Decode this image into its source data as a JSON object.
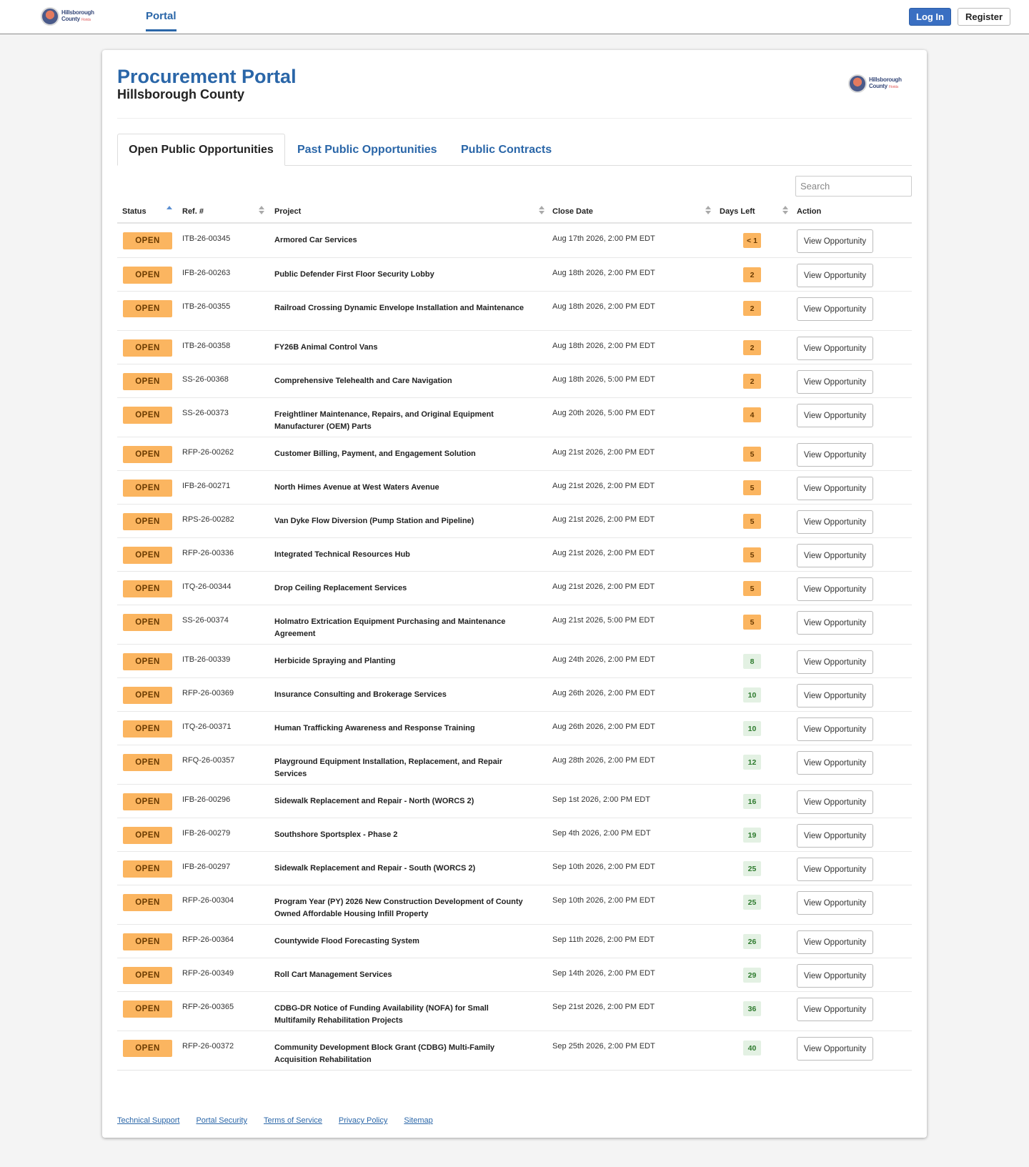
{
  "nav": {
    "logo_line1": "Hillsborough",
    "logo_line2": "County",
    "logo_tag": "Florida",
    "portal_label": "Portal",
    "login_label": "Log In",
    "register_label": "Register"
  },
  "header": {
    "title": "Procurement Portal",
    "subtitle": "Hillsborough County"
  },
  "tabs": [
    {
      "label": "Open Public Opportunities",
      "active": true
    },
    {
      "label": "Past Public Opportunities",
      "active": false
    },
    {
      "label": "Public Contracts",
      "active": false
    }
  ],
  "search": {
    "placeholder": "Search",
    "value": ""
  },
  "table": {
    "columns": [
      "Status",
      "Ref. #",
      "Project",
      "Close Date",
      "Days Left",
      "Action"
    ],
    "sorted_by": "Status",
    "sort_direction": "ascending",
    "action_label": "View Opportunity",
    "rows": [
      {
        "status": "OPEN",
        "ref": "ITB-26-00345",
        "project": "Armored Car Services",
        "close": "Aug 17th 2026, 2:00 PM EDT",
        "days": "< 1",
        "urgency": "warn"
      },
      {
        "status": "OPEN",
        "ref": "IFB-26-00263",
        "project": "Public Defender First Floor Security Lobby",
        "close": "Aug 18th 2026, 2:00 PM EDT",
        "days": "2",
        "urgency": "warn"
      },
      {
        "status": "OPEN",
        "ref": "ITB-26-00355",
        "project": "Railroad Crossing Dynamic Envelope Installation and Maintenance",
        "close": "Aug 18th 2026, 2:00 PM EDT",
        "days": "2",
        "urgency": "warn"
      },
      {
        "status": "OPEN",
        "ref": "ITB-26-00358",
        "project": "FY26B Animal Control Vans",
        "close": "Aug 18th 2026, 2:00 PM EDT",
        "days": "2",
        "urgency": "warn"
      },
      {
        "status": "OPEN",
        "ref": "SS-26-00368",
        "project": "Comprehensive Telehealth and Care Navigation",
        "close": "Aug 18th 2026, 5:00 PM EDT",
        "days": "2",
        "urgency": "warn"
      },
      {
        "status": "OPEN",
        "ref": "SS-26-00373",
        "project": "Freightliner Maintenance, Repairs, and Original Equipment Manufacturer (OEM) Parts",
        "close": "Aug 20th 2026, 5:00 PM EDT",
        "days": "4",
        "urgency": "warn"
      },
      {
        "status": "OPEN",
        "ref": "RFP-26-00262",
        "project": "Customer Billing, Payment, and Engagement Solution",
        "close": "Aug 21st 2026, 2:00 PM EDT",
        "days": "5",
        "urgency": "warn"
      },
      {
        "status": "OPEN",
        "ref": "IFB-26-00271",
        "project": "North Himes Avenue at West Waters Avenue",
        "close": "Aug 21st 2026, 2:00 PM EDT",
        "days": "5",
        "urgency": "warn"
      },
      {
        "status": "OPEN",
        "ref": "RPS-26-00282",
        "project": "Van Dyke Flow Diversion (Pump Station and Pipeline)",
        "close": "Aug 21st 2026, 2:00 PM EDT",
        "days": "5",
        "urgency": "warn"
      },
      {
        "status": "OPEN",
        "ref": "RFP-26-00336",
        "project": "Integrated Technical Resources Hub",
        "close": "Aug 21st 2026, 2:00 PM EDT",
        "days": "5",
        "urgency": "warn"
      },
      {
        "status": "OPEN",
        "ref": "ITQ-26-00344",
        "project": "Drop Ceiling Replacement Services",
        "close": "Aug 21st 2026, 2:00 PM EDT",
        "days": "5",
        "urgency": "warn"
      },
      {
        "status": "OPEN",
        "ref": "SS-26-00374",
        "project": "Holmatro Extrication Equipment Purchasing and Maintenance Agreement",
        "close": "Aug 21st 2026, 5:00 PM EDT",
        "days": "5",
        "urgency": "warn"
      },
      {
        "status": "OPEN",
        "ref": "ITB-26-00339",
        "project": "Herbicide Spraying and Planting",
        "close": "Aug 24th 2026, 2:00 PM EDT",
        "days": "8",
        "urgency": "ok"
      },
      {
        "status": "OPEN",
        "ref": "RFP-26-00369",
        "project": "Insurance Consulting and Brokerage Services",
        "close": "Aug 26th 2026, 2:00 PM EDT",
        "days": "10",
        "urgency": "ok"
      },
      {
        "status": "OPEN",
        "ref": "ITQ-26-00371",
        "project": "Human Trafficking Awareness and Response Training",
        "close": "Aug 26th 2026, 2:00 PM EDT",
        "days": "10",
        "urgency": "ok"
      },
      {
        "status": "OPEN",
        "ref": "RFQ-26-00357",
        "project": "Playground Equipment Installation, Replacement, and Repair Services",
        "close": "Aug 28th 2026, 2:00 PM EDT",
        "days": "12",
        "urgency": "ok"
      },
      {
        "status": "OPEN",
        "ref": "IFB-26-00296",
        "project": "Sidewalk Replacement and Repair - North (WORCS 2)",
        "close": "Sep 1st 2026, 2:00 PM EDT",
        "days": "16",
        "urgency": "ok"
      },
      {
        "status": "OPEN",
        "ref": "IFB-26-00279",
        "project": "Southshore Sportsplex - Phase 2",
        "close": "Sep 4th 2026, 2:00 PM EDT",
        "days": "19",
        "urgency": "ok"
      },
      {
        "status": "OPEN",
        "ref": "IFB-26-00297",
        "project": "Sidewalk Replacement and Repair - South (WORCS 2)",
        "close": "Sep 10th 2026, 2:00 PM EDT",
        "days": "25",
        "urgency": "ok"
      },
      {
        "status": "OPEN",
        "ref": "RFP-26-00304",
        "project": "Program Year (PY) 2026 New Construction Development of County Owned Affordable Housing Infill Property",
        "close": "Sep 10th 2026, 2:00 PM EDT",
        "days": "25",
        "urgency": "ok"
      },
      {
        "status": "OPEN",
        "ref": "RFP-26-00364",
        "project": "Countywide Flood Forecasting System",
        "close": "Sep 11th 2026, 2:00 PM EDT",
        "days": "26",
        "urgency": "ok"
      },
      {
        "status": "OPEN",
        "ref": "RFP-26-00349",
        "project": "Roll Cart Management Services",
        "close": "Sep 14th 2026, 2:00 PM EDT",
        "days": "29",
        "urgency": "ok"
      },
      {
        "status": "OPEN",
        "ref": "RFP-26-00365",
        "project": "CDBG-DR Notice of Funding Availability (NOFA) for Small Multifamily Rehabilitation Projects",
        "close": "Sep 21st 2026, 2:00 PM EDT",
        "days": "36",
        "urgency": "ok"
      },
      {
        "status": "OPEN",
        "ref": "RFP-26-00372",
        "project": "Community Development Block Grant (CDBG) Multi-Family Acquisition Rehabilitation",
        "close": "Sep 25th 2026, 2:00 PM EDT",
        "days": "40",
        "urgency": "ok"
      }
    ]
  },
  "footer": {
    "links": [
      "Technical Support",
      "Portal Security",
      "Terms of Service",
      "Privacy Policy",
      "Sitemap"
    ]
  },
  "colors": {
    "brand_blue": "#2a66a8",
    "open_badge": "#fbb560",
    "days_ok": "#e3f1e3"
  }
}
